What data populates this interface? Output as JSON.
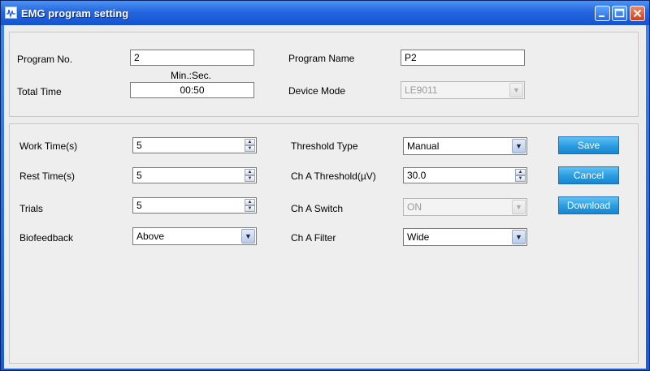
{
  "window": {
    "title": "EMG program setting"
  },
  "program": {
    "program_no_label": "Program No.",
    "program_no_value": "2",
    "program_name_label": "Program Name",
    "program_name_value": "P2",
    "min_sec_label": "Min.:Sec.",
    "total_time_label": "Total Time",
    "total_time_value": "00:50",
    "device_mode_label": "Device Mode",
    "device_mode_value": "LE9011"
  },
  "settings": {
    "work_time_label": "Work Time(s)",
    "work_time_value": "5",
    "rest_time_label": "Rest Time(s)",
    "rest_time_value": "5",
    "trials_label": "Trials",
    "trials_value": "5",
    "biofeedback_label": "Biofeedback",
    "biofeedback_value": "Above",
    "threshold_type_label": "Threshold Type",
    "threshold_type_value": "Manual",
    "ch_a_threshold_label": "Ch A Threshold(µV)",
    "ch_a_threshold_value": "30.0",
    "ch_a_switch_label": "Ch A Switch",
    "ch_a_switch_value": "ON",
    "ch_a_filter_label": "Ch A Filter",
    "ch_a_filter_value": "Wide"
  },
  "actions": {
    "save_label": "Save",
    "cancel_label": "Cancel",
    "download_label": "Download"
  }
}
